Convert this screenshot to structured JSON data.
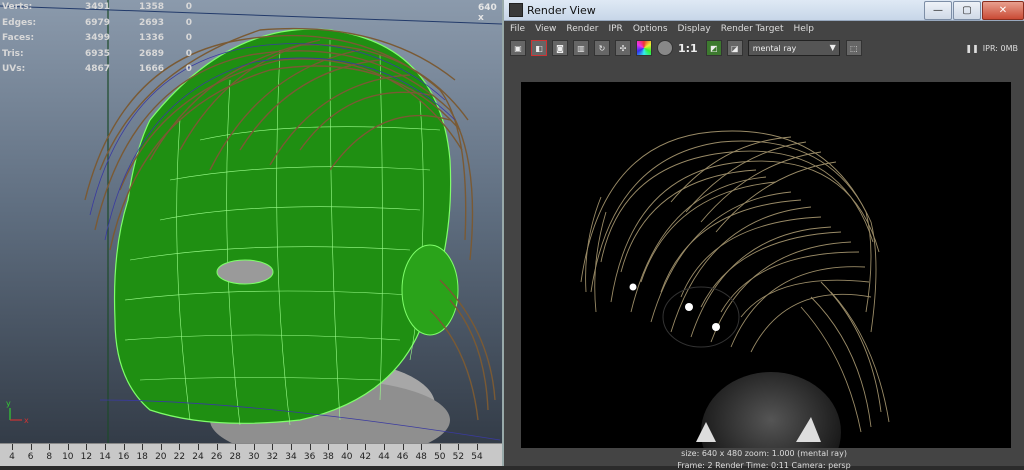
{
  "viewport": {
    "stats": [
      {
        "label": "Verts:",
        "v1": "3491",
        "v2": "1358",
        "v3": "0"
      },
      {
        "label": "Edges:",
        "v1": "6979",
        "v2": "2693",
        "v3": "0"
      },
      {
        "label": "Faces:",
        "v1": "3499",
        "v2": "1336",
        "v3": "0"
      },
      {
        "label": "Tris:",
        "v1": "6935",
        "v2": "2689",
        "v3": "0"
      },
      {
        "label": "UVs:",
        "v1": "4867",
        "v2": "1666",
        "v3": "0"
      }
    ],
    "resolution_text": "640 x",
    "axis_x": "x",
    "axis_y": "y"
  },
  "timeline": {
    "ticks": [
      "4",
      "6",
      "8",
      "10",
      "12",
      "14",
      "16",
      "18",
      "20",
      "22",
      "24",
      "26",
      "28",
      "30",
      "32",
      "34",
      "36",
      "38",
      "40",
      "42",
      "44",
      "46",
      "48",
      "50",
      "52",
      "54"
    ]
  },
  "render_view": {
    "title": "Render View",
    "window_buttons": {
      "minimize": "—",
      "maximize": "▢",
      "close": "✕"
    },
    "menu": [
      "File",
      "View",
      "Render",
      "IPR",
      "Options",
      "Display",
      "Render Target",
      "Help"
    ],
    "ratio_label": "1:1",
    "renderer": "mental ray",
    "ipr_label": "IPR: 0MB",
    "info_line": "size: 640 x 480  zoom: 1.000       (mental ray)",
    "info_line2": "Frame: 2      Render Time: 0:11       Camera: persp"
  }
}
